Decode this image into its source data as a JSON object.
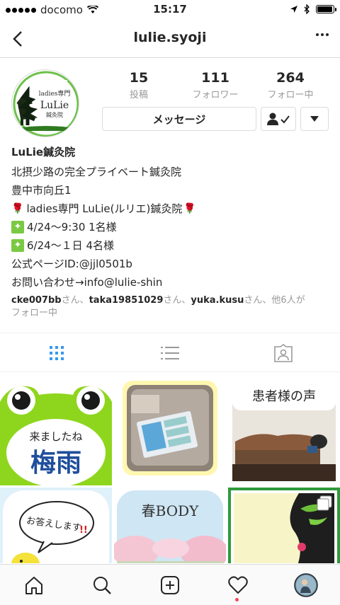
{
  "status_bar": {
    "carrier": "docomo",
    "time": "15:17",
    "battery_level": 0.95
  },
  "nav": {
    "title": "lulie.syoji"
  },
  "avatar": {
    "logo_line1": "ladies専門",
    "logo_line2": "LuLie",
    "logo_line3": "鍼灸院"
  },
  "stats": [
    {
      "count": "15",
      "label": "投稿"
    },
    {
      "count": "111",
      "label": "フォロワー"
    },
    {
      "count": "264",
      "label": "フォロー中"
    }
  ],
  "buttons": {
    "message": "メッセージ"
  },
  "bio": {
    "name": "LuLie鍼灸院",
    "line1": "北摂少路の完全プライベート鍼灸院",
    "line2": "豊中市向丘1",
    "line3": "ladies専門 LuLie(ルリエ)鍼灸院",
    "line4": "4/24〜9:30 1名様",
    "line5": "6/24〜１日 4名様",
    "line6": "公式ページID:@jjl0501b",
    "line7": "お問い合わせ→info@lulie-shin"
  },
  "followed_by": {
    "user1": "cke007bb",
    "sep1": "さん、",
    "user2": "taka19851029",
    "sep2": "さん、",
    "user3": "yuka.kusu",
    "sep3": "さん、他6人が",
    "line2": "フォロー中"
  },
  "posts": {
    "post1_small": "来ましたね",
    "post1_big": "梅雨",
    "post3_text": "患者様の声",
    "post4_text": "お答えします",
    "post4_mark": "!!",
    "post5_text": "春BODY"
  },
  "colors": {
    "accent_green": "#7ac943",
    "frog_green": "#8ed61d",
    "notif_red": "#ed4956"
  }
}
